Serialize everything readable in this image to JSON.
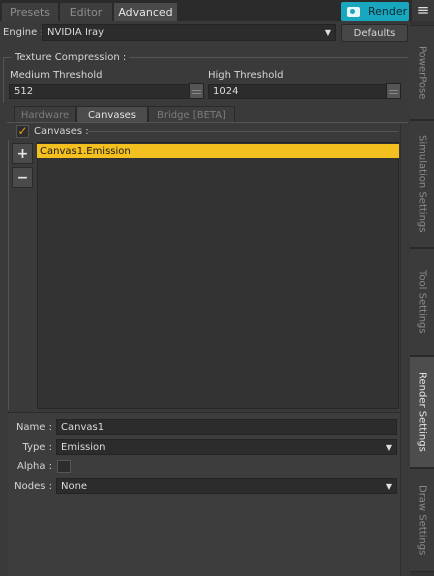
{
  "top_tabs": [
    "Presets",
    "Editor",
    "Advanced"
  ],
  "active_top_tab": "Advanced",
  "render_button": {
    "label": "Render",
    "icon": "camera-icon",
    "color": "#19a6bf"
  },
  "menu_icon": "≡",
  "engine": {
    "label": "Engine :",
    "value": "NVIDIA Iray",
    "defaults_label": "Defaults"
  },
  "texture_compression": {
    "title": "Texture Compression :",
    "medium_label": "Medium Threshold",
    "medium_value": "512",
    "high_label": "High Threshold",
    "high_value": "1024"
  },
  "sub_tabs": [
    "Hardware",
    "Canvases",
    "Bridge [BETA]"
  ],
  "active_sub_tab": "Canvases",
  "canvases": {
    "title": "Canvases :",
    "checked": true,
    "check_glyph": "✓",
    "add_glyph": "+",
    "remove_glyph": "−",
    "items": [
      "Canvas1.Emission"
    ],
    "selected_color": "#f4c020"
  },
  "properties": {
    "name_label": "Name :",
    "name_value": "Canvas1",
    "type_label": "Type :",
    "type_value": "Emission",
    "alpha_label": "Alpha :",
    "nodes_label": "Nodes :",
    "nodes_value": "None"
  },
  "right_tabs": [
    "PowerPose",
    "Simulation Settings",
    "Tool Settings",
    "Render Settings",
    "Draw Settings"
  ],
  "active_right_tab": "Render Settings"
}
